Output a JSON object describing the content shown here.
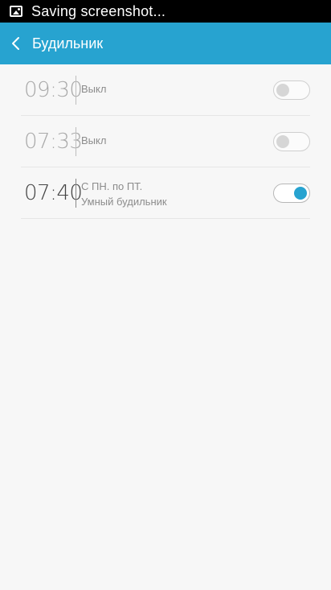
{
  "status_bar": {
    "text": "Saving screenshot..."
  },
  "app_bar": {
    "title": "Будильник"
  },
  "alarms": [
    {
      "time": "09:30",
      "line1": "Выкл",
      "line2": "",
      "enabled": false
    },
    {
      "time": "07:33",
      "line1": "Выкл",
      "line2": "",
      "enabled": false
    },
    {
      "time": "07:40",
      "line1": "С ПН. по ПТ.",
      "line2": "Умный будильник",
      "enabled": true
    }
  ],
  "colors": {
    "accent": "#27a3d0",
    "status_bar": "#000000",
    "background": "#f7f7f7"
  }
}
